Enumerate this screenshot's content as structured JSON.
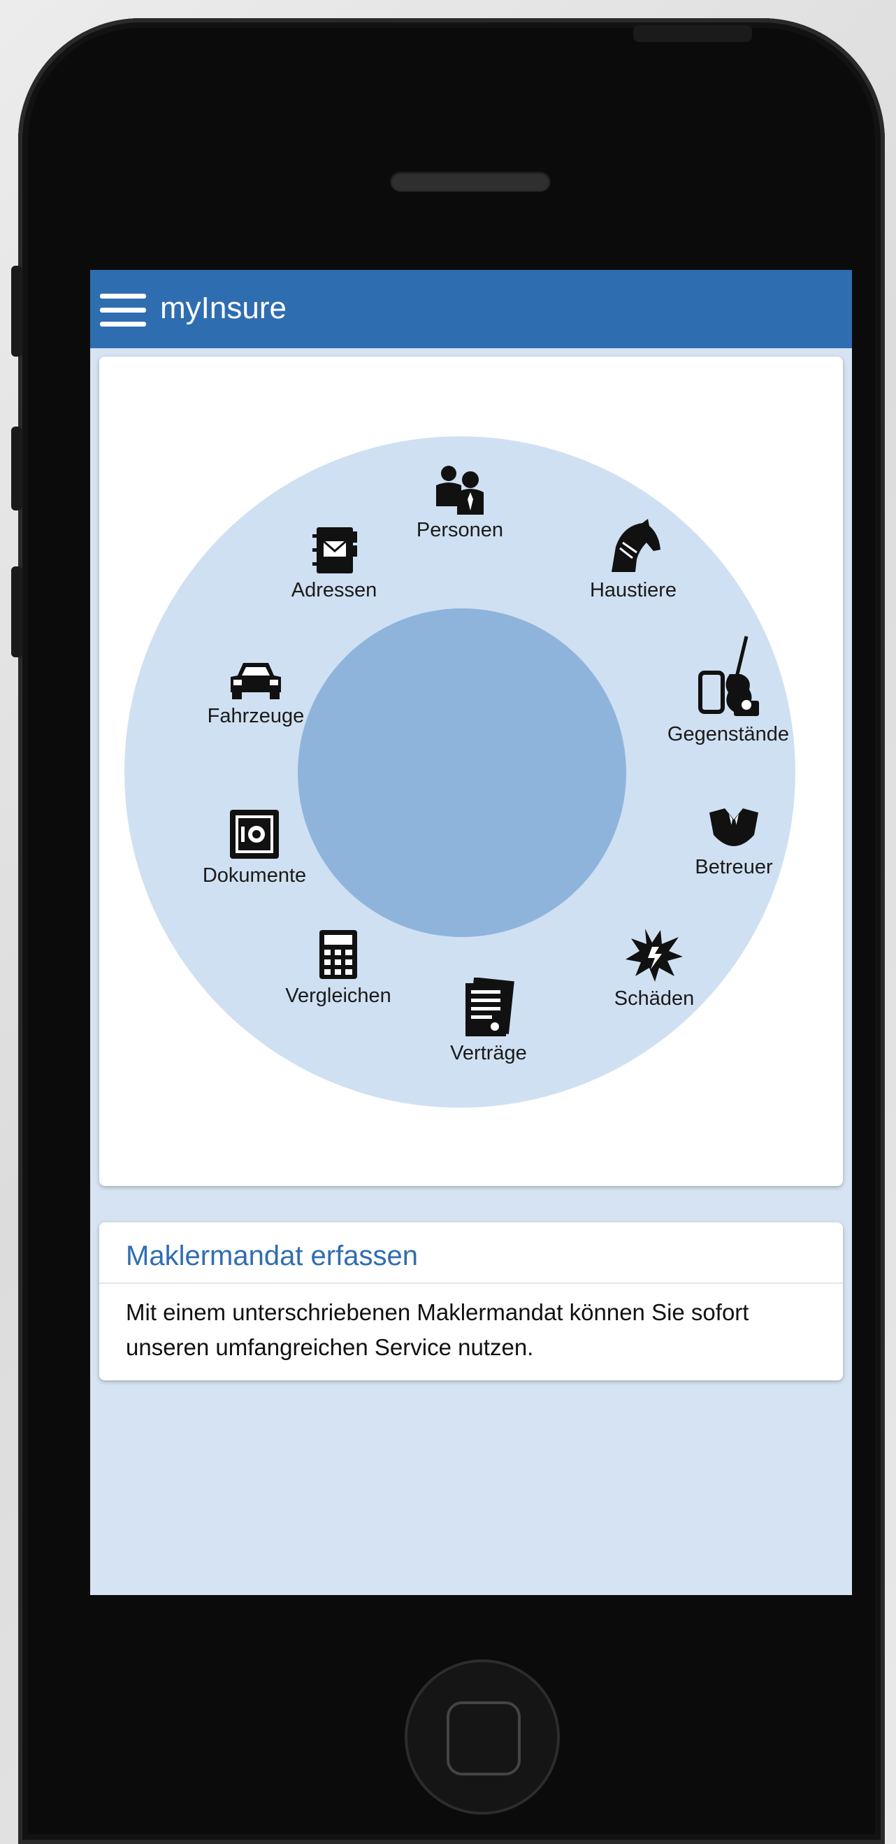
{
  "app": {
    "title": "myInsure"
  },
  "wheel": {
    "items": [
      {
        "label": "Personen",
        "icon": "people-icon"
      },
      {
        "label": "Haustiere",
        "icon": "horse-icon"
      },
      {
        "label": "Gegenstände",
        "icon": "phone-guitar-icon"
      },
      {
        "label": "Betreuer",
        "icon": "suit-icon"
      },
      {
        "label": "Schäden",
        "icon": "explosion-icon"
      },
      {
        "label": "Verträge",
        "icon": "contract-icon"
      },
      {
        "label": "Vergleichen",
        "icon": "calculator-icon"
      },
      {
        "label": "Dokumente",
        "icon": "safe-icon"
      },
      {
        "label": "Fahrzeuge",
        "icon": "car-icon"
      },
      {
        "label": "Adressen",
        "icon": "address-book-icon"
      }
    ]
  },
  "mandate_card": {
    "title": "Maklermandat erfassen",
    "text": "Mit einem unterschriebenen Maklermandat können Sie sofort unseren umfangreichen Service nutzen."
  },
  "colors": {
    "appbar": "#2f6db1",
    "background": "#d5e3f2",
    "outer_circle": "#cfe0f2",
    "inner_circle": "#8fb4dc"
  }
}
